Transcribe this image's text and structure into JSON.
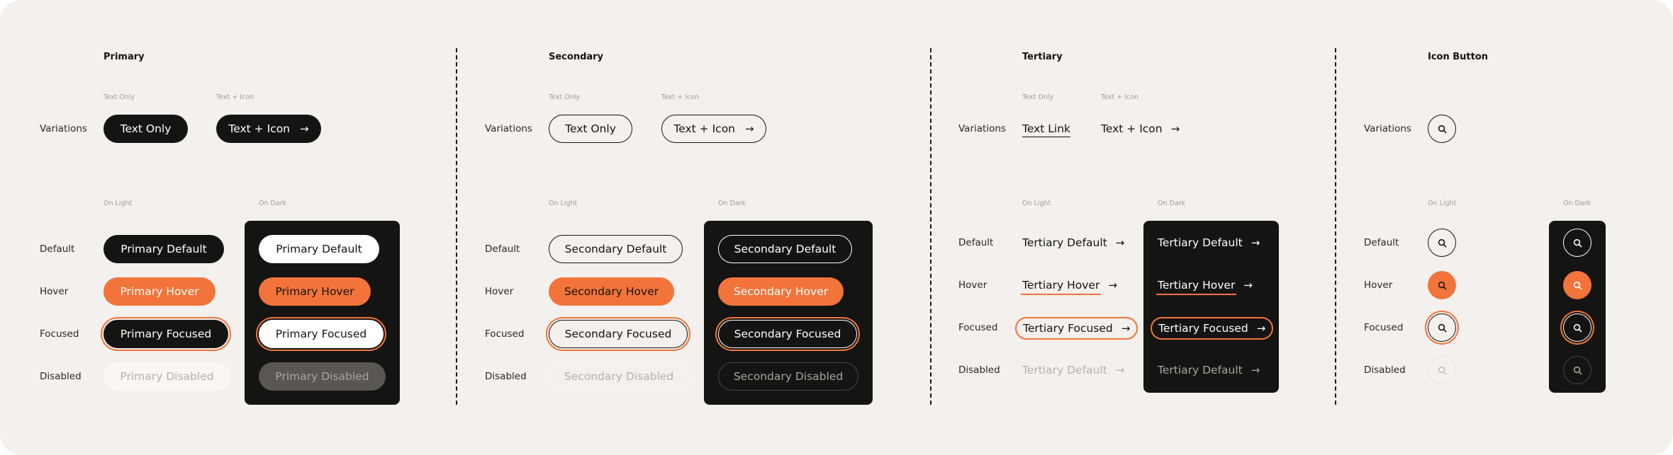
{
  "colors": {
    "accent": "#F2743A",
    "dark": "#141412",
    "background": "#F3F0ED",
    "white": "#FFFFFF"
  },
  "row_labels": {
    "variations": "Variations",
    "default": "Default",
    "hover": "Hover",
    "focused": "Focused",
    "disabled": "Disabled"
  },
  "captions": {
    "text_only": "Text Only",
    "text_icon": "Text + Icon",
    "on_light": "On Light",
    "on_dark": "On Dark"
  },
  "icons": {
    "arrow": "arrow-right-icon",
    "search": "search-icon"
  },
  "primary": {
    "title": "Primary",
    "variations": {
      "text_only": "Text Only",
      "text_icon": "Text + Icon"
    },
    "on_light": {
      "default": "Primary Default",
      "hover": "Primary Hover",
      "focused": "Primary Focused",
      "disabled": "Primary Disabled"
    },
    "on_dark": {
      "default": "Primary Default",
      "hover": "Primary Hover",
      "focused": "Primary Focused",
      "disabled": "Primary Disabled"
    }
  },
  "secondary": {
    "title": "Secondary",
    "variations": {
      "text_only": "Text Only",
      "text_icon": "Text + Icon"
    },
    "on_light": {
      "default": "Secondary Default",
      "hover": "Secondary Hover",
      "focused": "Secondary Focused",
      "disabled": "Secondary Disabled"
    },
    "on_dark": {
      "default": "Secondary Default",
      "hover": "Secondary Hover",
      "focused": "Secondary Focused",
      "disabled": "Secondary Disabled"
    }
  },
  "tertiary": {
    "title": "Tertiary",
    "variations": {
      "text_only": "Text Link",
      "text_icon": "Text + Icon"
    },
    "on_light": {
      "default": "Tertiary Default",
      "hover": "Tertiary Hover",
      "focused": "Tertiary Focused",
      "disabled": "Tertiary Default"
    },
    "on_dark": {
      "default": "Tertiary Default",
      "hover": "Tertiary Hover",
      "focused": "Tertiary Focused",
      "disabled": "Tertiary Default"
    }
  },
  "icon_button": {
    "title": "Icon Button"
  }
}
